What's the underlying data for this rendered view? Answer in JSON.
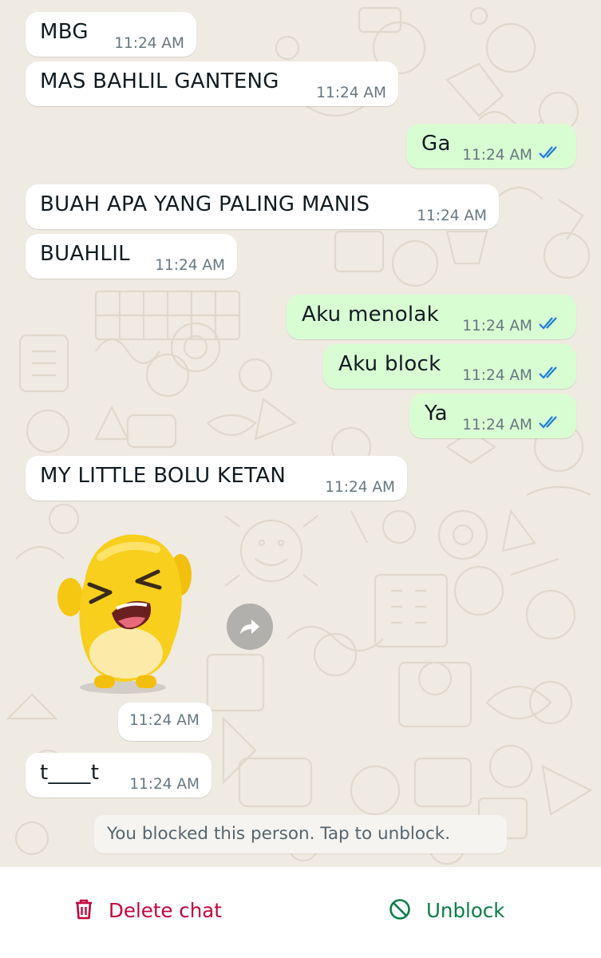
{
  "messages": [
    {
      "dir": "in",
      "text": "MBG",
      "time": "11:24 AM"
    },
    {
      "dir": "in",
      "text": "MAS BAHLIL GANTENG",
      "time": "11:24 AM"
    },
    {
      "dir": "out",
      "text": "Ga",
      "time": "11:24 AM",
      "status": "read"
    },
    {
      "dir": "in",
      "text": "BUAH APA YANG PALING MANIS",
      "time": "11:24 AM"
    },
    {
      "dir": "in",
      "text": "BUAHLIL",
      "time": "11:24 AM"
    },
    {
      "dir": "out",
      "text": "Aku menolak",
      "time": "11:24 AM",
      "status": "read"
    },
    {
      "dir": "out",
      "text": "Aku block",
      "time": "11:24 AM",
      "status": "read"
    },
    {
      "dir": "out",
      "text": "Ya",
      "time": "11:24 AM",
      "status": "read"
    },
    {
      "dir": "in",
      "text": "MY LITTLE BOLU KETAN",
      "time": "11:24 AM"
    },
    {
      "dir": "in",
      "text": "t____t",
      "time": "11:24 AM"
    }
  ],
  "sticker": {
    "icon": "yellow-character-sticker",
    "time": "11:24 AM",
    "forward_icon": "forward-icon"
  },
  "system_message": "You blocked this person. Tap to unblock.",
  "footer": {
    "delete_label": "Delete chat",
    "delete_icon": "trash-icon",
    "delete_color": "#c3063d",
    "unblock_label": "Unblock",
    "unblock_icon": "block-icon",
    "unblock_color": "#0a7d47"
  },
  "colors": {
    "background": "#efeae2",
    "incoming": "#ffffff",
    "outgoing": "#d9fdd3",
    "read_ticks": "#1f7ae0"
  }
}
